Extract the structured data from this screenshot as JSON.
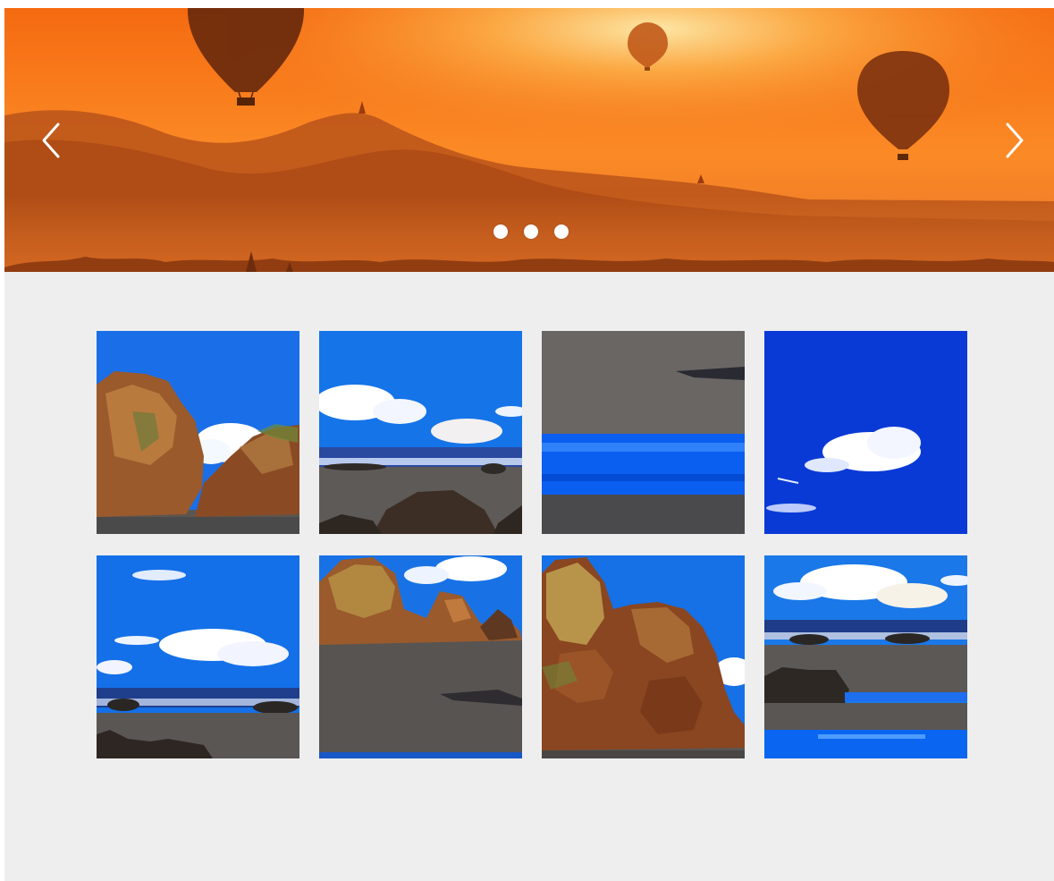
{
  "carousel": {
    "slide_count": 3,
    "active_slide": 1,
    "prev_icon": "chevron-left-icon",
    "next_icon": "chevron-right-icon",
    "colors": {
      "sky_top": "#f06a12",
      "sky_glow": "#fcc86a",
      "hills": "#b44a12",
      "mist": "#e07a2a"
    }
  },
  "gallery": {
    "columns": 4,
    "rows": 2,
    "thumbnails": [
      {
        "subject": "coastal-rock-formation"
      },
      {
        "subject": "beach-with-clouds-and-rocks"
      },
      {
        "subject": "wet-sand-and-water"
      },
      {
        "subject": "blue-sky-single-cloud"
      },
      {
        "subject": "ocean-horizon-clouds"
      },
      {
        "subject": "rocks-over-sandy-beach"
      },
      {
        "subject": "tall-rock-outcrop"
      },
      {
        "subject": "seaside-rocks-tide-pool"
      }
    ]
  },
  "colors": {
    "page_background": "#eeeeee",
    "sky_blue": "#1565e0",
    "sand": "#5a5a5a",
    "rock": "#8a4a22"
  }
}
